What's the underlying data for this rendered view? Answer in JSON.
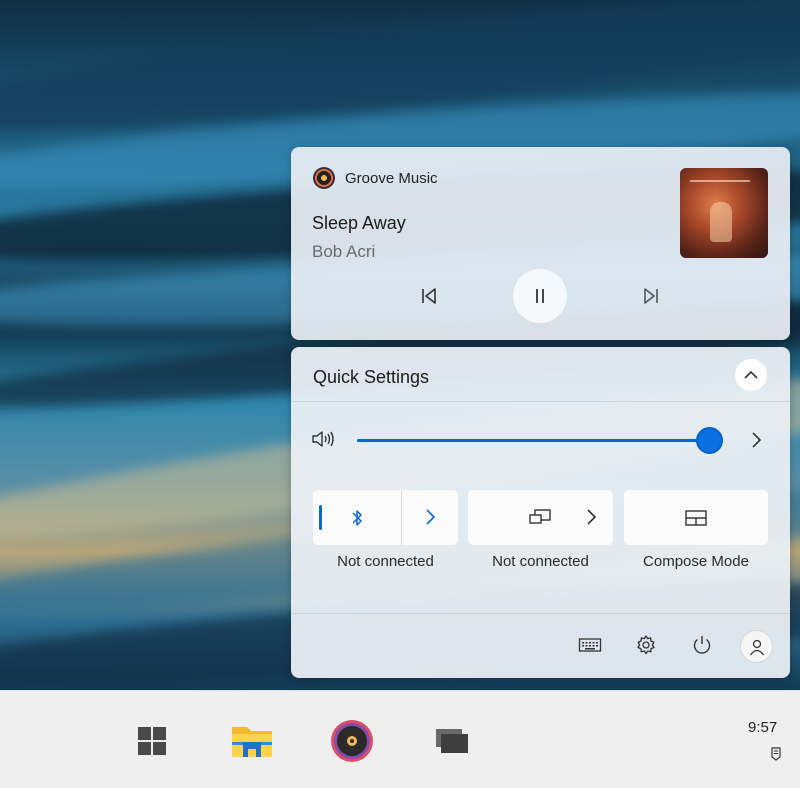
{
  "media": {
    "app_name": "Groove Music",
    "track_title": "Sleep Away",
    "artist": "Bob Acri",
    "icons": {
      "app": "groove-music-icon",
      "previous": "previous-track-icon",
      "pause": "pause-icon",
      "next": "next-track-icon",
      "album_art": "album-art"
    }
  },
  "quick_settings": {
    "title": "Quick Settings",
    "volume_level": 1.0,
    "tiles": [
      {
        "label": "Not connected",
        "icon": "bluetooth-icon",
        "active": true
      },
      {
        "label": "Not connected",
        "icon": "cast-icon",
        "active": false
      },
      {
        "label": "Compose Mode",
        "icon": "compose-mode-icon",
        "active": false
      }
    ],
    "footer_icons": [
      "keyboard-icon",
      "settings-gear-icon",
      "power-icon",
      "user-account-icon"
    ]
  },
  "taskbar": {
    "clock": "9:57",
    "icons": [
      "windows-start-icon",
      "file-explorer-icon",
      "groove-music-icon",
      "task-view-icon",
      "notification-icon"
    ]
  },
  "colors": {
    "accent": "#0a68d6",
    "panel": "#ebf0f5",
    "taskbar": "#efefef"
  }
}
